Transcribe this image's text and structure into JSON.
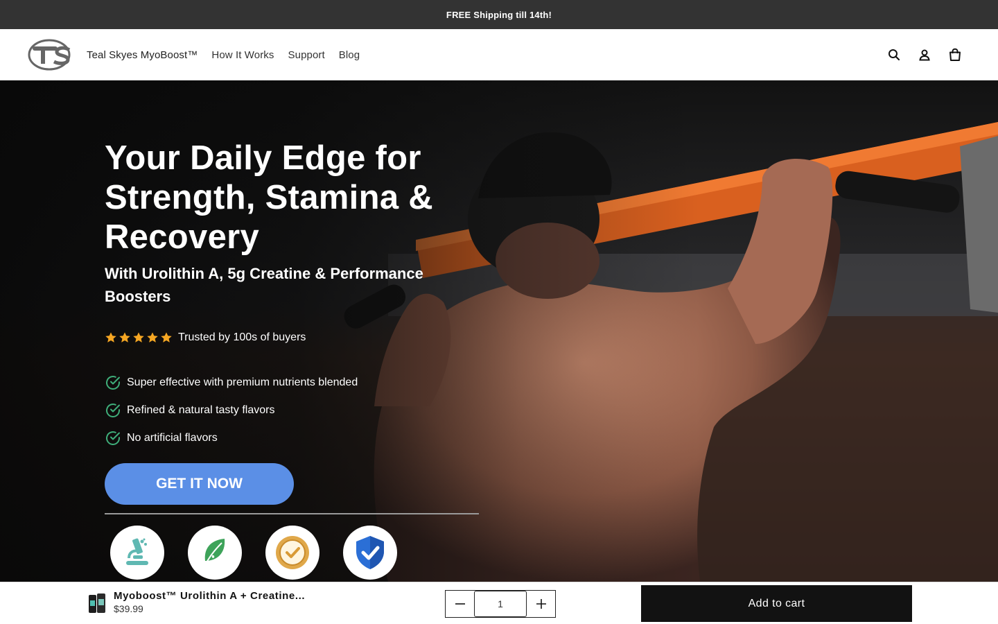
{
  "announcement": {
    "text": "FREE Shipping till 14th!"
  },
  "header": {
    "logo_text": "TS",
    "nav": [
      {
        "label": "Teal Skyes MyoBoost™"
      },
      {
        "label": "How It Works"
      },
      {
        "label": "Support"
      },
      {
        "label": "Blog"
      }
    ],
    "icons": [
      "search-icon",
      "account-icon",
      "cart-icon"
    ]
  },
  "hero": {
    "title": "Your Daily Edge for Strength, Stamina & Recovery",
    "subtitle": "With Urolithin A, 5g Creatine & Performance Boosters",
    "rating": {
      "stars": 5,
      "text": "Trusted by 100s of buyers",
      "star_color": "#f5a623"
    },
    "benefits": [
      "Super effective with premium nutrients blended",
      "Refined & natural tasty flavors",
      "No artificial flavors"
    ],
    "cta_label": "GET IT NOW",
    "cta_color": "#5b8fe6",
    "badges": [
      "microscope-icon",
      "leaf-icon",
      "quality-seal-icon",
      "shield-check-icon"
    ]
  },
  "sticky_cart": {
    "product_name": "Myoboost™ Urolithin A + Creatine...",
    "price": "$39.99",
    "quantity": "1",
    "add_label": "Add to cart"
  }
}
